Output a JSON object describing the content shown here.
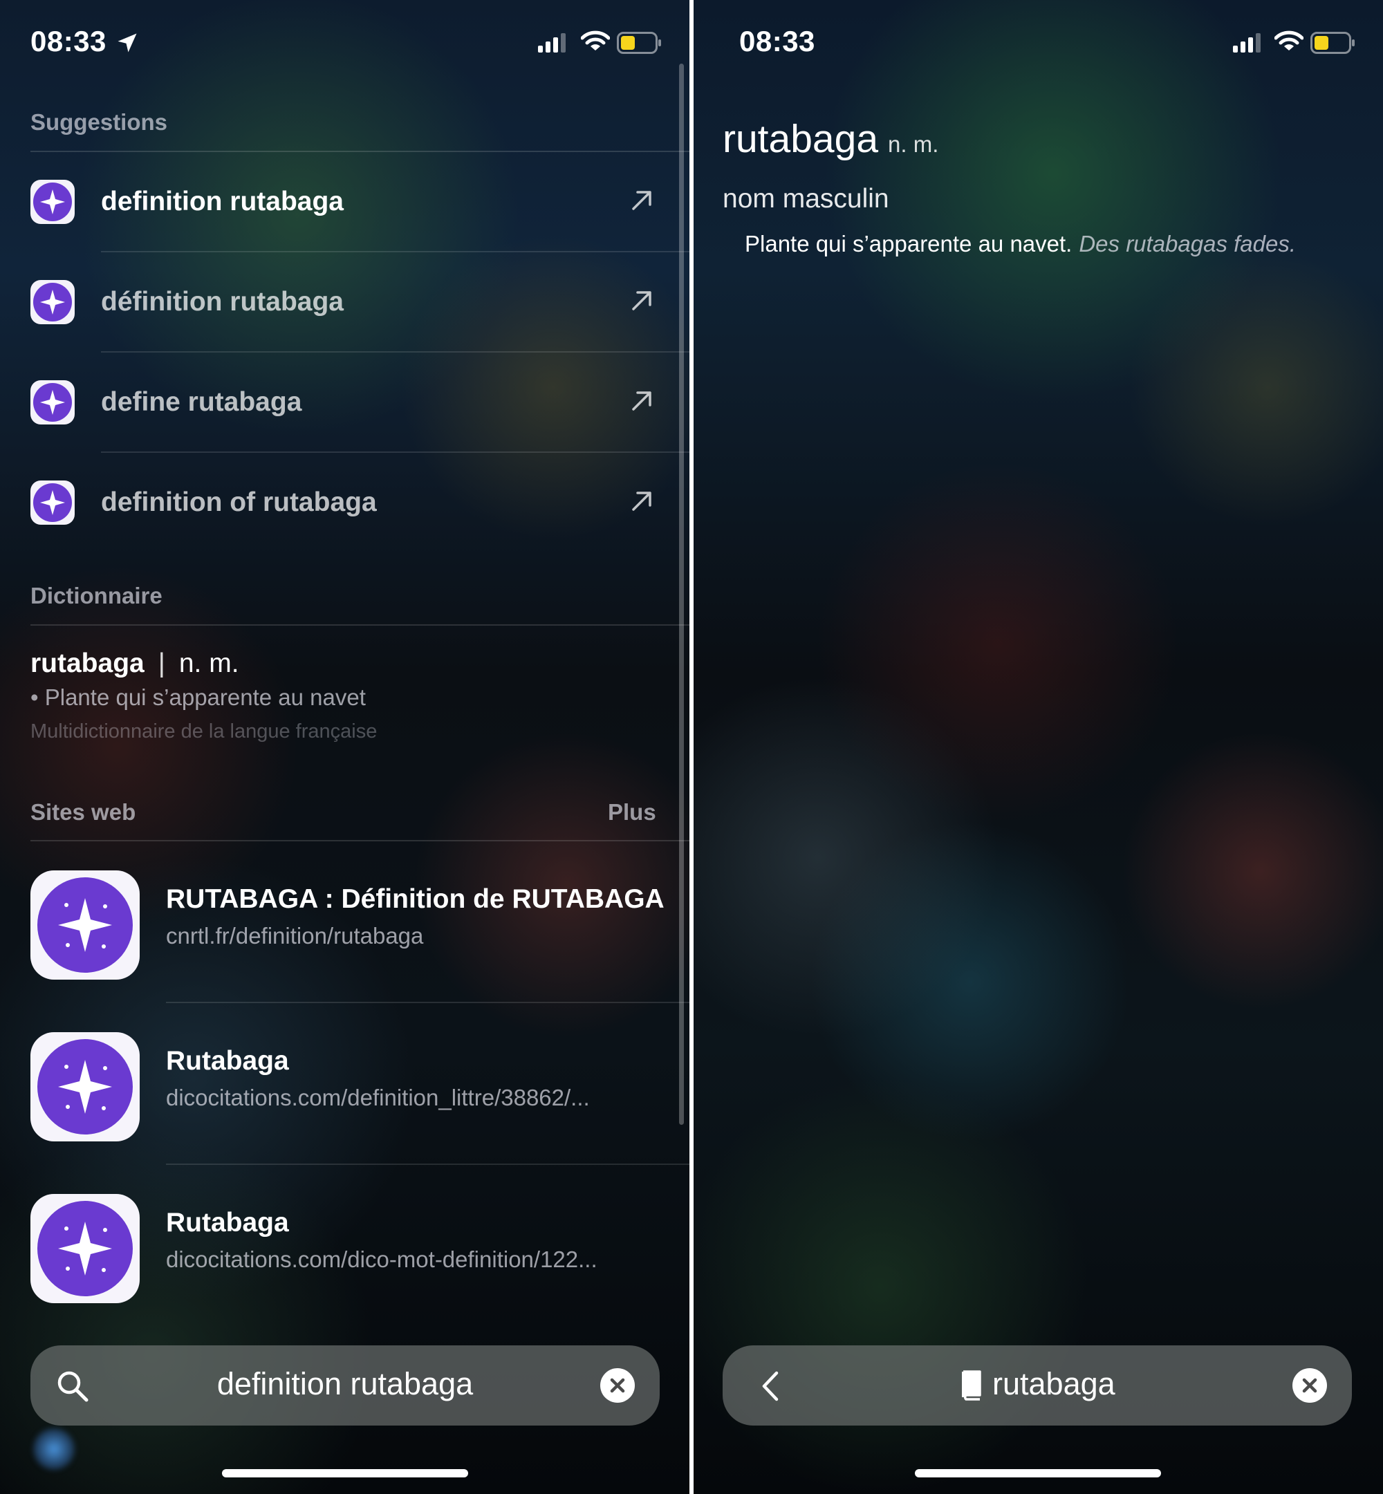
{
  "left": {
    "status": {
      "time": "08:33"
    },
    "suggestions": {
      "header": "Suggestions",
      "items": [
        {
          "label": "definition rutabaga"
        },
        {
          "label": "définition rutabaga"
        },
        {
          "label": "define rutabaga"
        },
        {
          "label": "definition of rutabaga"
        }
      ]
    },
    "dictionary": {
      "header": "Dictionnaire",
      "word": "rutabaga",
      "separator": "|",
      "pos": "n. m.",
      "definition": "• Plante qui s’apparente au navet",
      "source": "Multidictionnaire de la langue française"
    },
    "websites": {
      "header": "Sites web",
      "more_label": "Plus",
      "items": [
        {
          "title": "RUTABAGA : Définition de RUTABAGA",
          "url": "cnrtl.fr/definition/rutabaga"
        },
        {
          "title": "Rutabaga",
          "url": "dicocitations.com/definition_littre/38862/..."
        },
        {
          "title": "Rutabaga",
          "url": "dicocitations.com/dico-mot-definition/122..."
        }
      ]
    },
    "search": {
      "query": "definition rutabaga"
    }
  },
  "right": {
    "status": {
      "time": "08:33"
    },
    "entry": {
      "word": "rutabaga",
      "pos": "n. m.",
      "type": "nom masculin",
      "definition": "Plante qui s’apparente au navet.",
      "example": "Des rutabagas fades."
    },
    "search": {
      "query": "rutabaga"
    }
  },
  "icons": {
    "status": [
      "location-arrow-icon",
      "signal-icon",
      "wifi-icon",
      "battery-icon"
    ],
    "app": "sparkle-app-icon",
    "suggestion_action": "arrow-up-right-icon",
    "search": "magnifier-icon",
    "clear": "clear-x-icon",
    "back": "chevron-left-icon",
    "dictionary": "book-icon"
  },
  "colors": {
    "battery_fill": "#f7d51d",
    "app_icon_purple": "#6a3ad0"
  }
}
